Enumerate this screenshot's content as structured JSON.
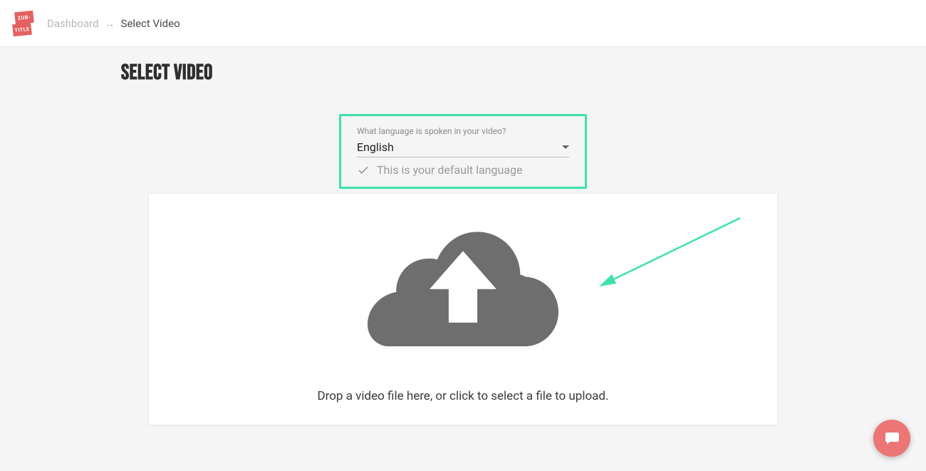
{
  "logo": {
    "line1": "ZUB-",
    "line2": "TITLE"
  },
  "breadcrumbs": {
    "dashboard": "Dashboard",
    "separator": "→",
    "current": "Select Video"
  },
  "page": {
    "title": "Select Video"
  },
  "language": {
    "prompt": "What language is spoken in your video?",
    "selected": "English",
    "default_hint": "This is your default language"
  },
  "upload": {
    "instruction": "Drop a video file here, or click to select a file to upload."
  },
  "colors": {
    "highlight": "#3de2a6",
    "brand": "#e56060",
    "fab": "#ec7575",
    "cloud": "#6e6e6e"
  }
}
